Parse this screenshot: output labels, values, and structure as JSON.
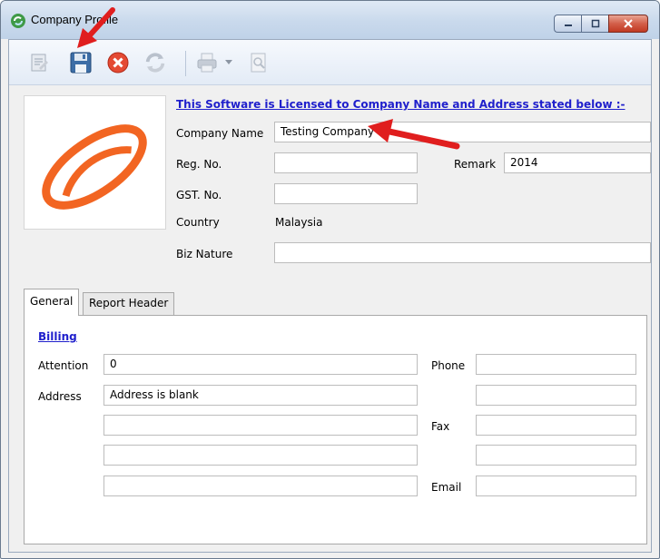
{
  "window": {
    "title": "Company Profile"
  },
  "toolbar": {
    "buttons": [
      {
        "name": "edit",
        "icon": "edit-note-icon"
      },
      {
        "name": "save",
        "icon": "save-floppy-icon"
      },
      {
        "name": "cancel",
        "icon": "cancel-icon"
      },
      {
        "name": "refresh",
        "icon": "refresh-icon"
      },
      {
        "name": "print",
        "icon": "printer-icon"
      },
      {
        "name": "preview",
        "icon": "print-preview-icon"
      }
    ]
  },
  "license": {
    "text": "This Software is Licensed to Company Name and Address stated below :-"
  },
  "company": {
    "name_label": "Company Name",
    "name_value": "Testing Company",
    "reg_label": "Reg. No.",
    "reg_value": "",
    "remark_label": "Remark",
    "remark_value": "2014",
    "gst_label": "GST. No.",
    "gst_value": "",
    "country_label": "Country",
    "country_value": "Malaysia",
    "biz_label": "Biz Nature",
    "biz_value": ""
  },
  "tabs": [
    {
      "label": "General",
      "active": true
    },
    {
      "label": "Report Header",
      "active": false
    }
  ],
  "billing": {
    "heading": "Billing",
    "attention_label": "Attention",
    "attention_value": "0",
    "address_label": "Address",
    "address_lines": [
      "Address is blank",
      "",
      "",
      ""
    ],
    "phone_label": "Phone",
    "phone_values": [
      "",
      ""
    ],
    "fax_label": "Fax",
    "fax_values": [
      "",
      ""
    ],
    "email_label": "Email",
    "email_value": ""
  },
  "colors": {
    "link": "#1f1fcc",
    "annotation_arrow": "#e01e1e",
    "logo_orange": "#f26522"
  }
}
